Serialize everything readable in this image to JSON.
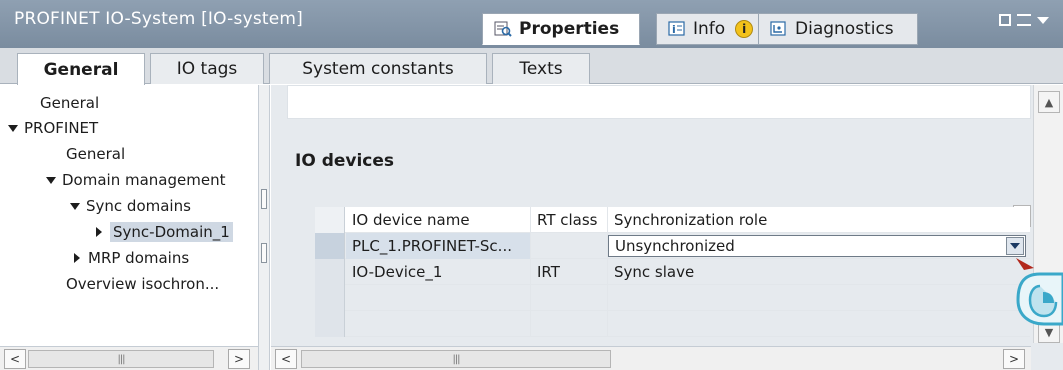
{
  "window": {
    "title": "PROFINET IO-System [IO-system]",
    "tabs": [
      {
        "label": "Properties",
        "icon": "properties-icon",
        "active": true
      },
      {
        "label": "Info",
        "icon": "info-icon",
        "active": false
      },
      {
        "label": "Diagnostics",
        "icon": "diagnostics-icon",
        "active": false
      }
    ],
    "info_badge": "i"
  },
  "subtabs": [
    {
      "label": "General",
      "active": true
    },
    {
      "label": "IO tags",
      "active": false
    },
    {
      "label": "System constants",
      "active": false
    },
    {
      "label": "Texts",
      "active": false
    }
  ],
  "tree": {
    "items": [
      {
        "label": "General"
      },
      {
        "label": "PROFINET"
      },
      {
        "label": "General"
      },
      {
        "label": "Domain management"
      },
      {
        "label": "Sync domains"
      },
      {
        "label": "Sync-Domain_1"
      },
      {
        "label": "MRP domains"
      },
      {
        "label": "Overview isochron..."
      }
    ]
  },
  "panel": {
    "section_title": "IO devices",
    "table": {
      "headers": [
        "IO device name",
        "RT class",
        "Synchronization role"
      ],
      "rows": [
        {
          "name": "PLC_1.PROFINET-Sc...",
          "rt_class": "",
          "role": "Unsynchronized"
        },
        {
          "name": "IO-Device_1",
          "rt_class": "IRT",
          "role": "Sync slave"
        }
      ]
    }
  },
  "colors": {
    "titlebar": "#7f91a4",
    "selection": "#cfd8e3",
    "accent_cursor": "#3aa8c9",
    "cursor_arrow": "#b2281c"
  }
}
